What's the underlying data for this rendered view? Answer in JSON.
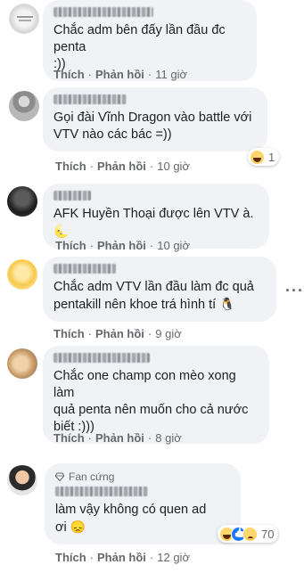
{
  "actions": {
    "like": "Thích",
    "reply": "Phản hồi",
    "separator": "·"
  },
  "comments": [
    {
      "text": "Chắc adm bên đấy lần đầu đc penta\n:))",
      "time": "11 giờ"
    },
    {
      "text": "Gọi đài Vĩnh Dragon vào battle với\nVTV nào các bác =))",
      "time": "10 giờ",
      "reaction_count": "1"
    },
    {
      "text": "AFK Huyền Thoại được lên VTV à.",
      "time": "10 giờ"
    },
    {
      "text": "Chắc adm VTV lần đầu làm đc quả\npentakill nên khoe trá hình tí",
      "time": "9 giờ"
    },
    {
      "text": "Chắc one champ con mèo xong làm\nquả penta nên muốn cho cả nước\nbiết :)))",
      "time": "8 giờ"
    },
    {
      "badge": "Fan cứng",
      "text": "làm vậy không có quen ad\nơi",
      "time": "12 giờ",
      "reaction_count": "70"
    }
  ],
  "icons": {
    "more": "more-horizontal-icon",
    "badge": "diamond-icon"
  }
}
